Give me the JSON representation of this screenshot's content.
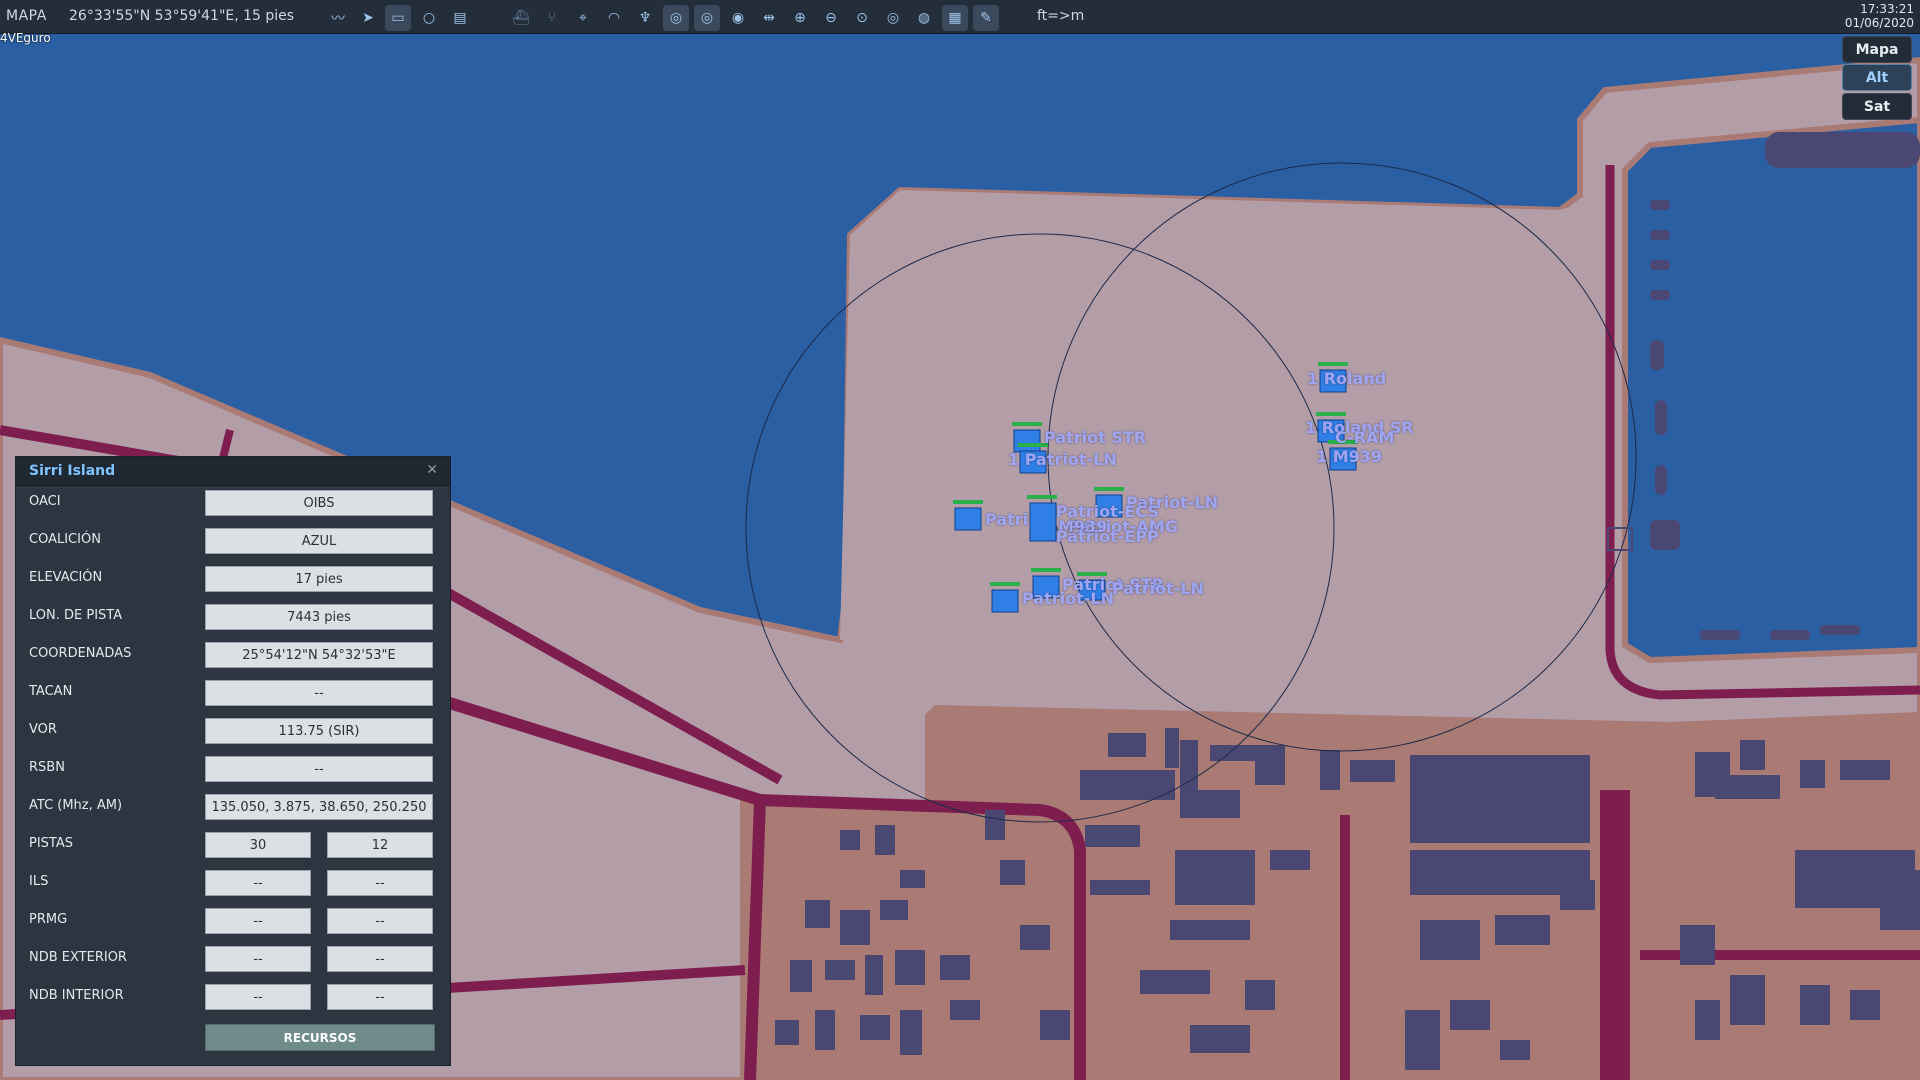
{
  "toolbar": {
    "mode": "MAPA",
    "coords": "26°33'55\"N 53°59'41\"E, 15 pies",
    "units": "ft=>m",
    "time": "17:33:21",
    "date": "01/06/2020",
    "tools": [
      {
        "icon": "route-icon"
      },
      {
        "icon": "navigate-arrow-icon"
      },
      {
        "icon": "ruler-icon"
      },
      {
        "icon": "circle-icon"
      },
      {
        "icon": "layers-icon"
      },
      {
        "icon": "ship-icon"
      },
      {
        "icon": "branch-icon"
      },
      {
        "icon": "crosshair-icon"
      },
      {
        "icon": "wifi-signal-icon"
      },
      {
        "icon": "antenna-icon"
      },
      {
        "icon": "radar-red-icon"
      },
      {
        "icon": "radar-blue-icon"
      },
      {
        "icon": "radar-all-icon"
      },
      {
        "icon": "pan-icon"
      },
      {
        "icon": "zoom-in-icon"
      },
      {
        "icon": "zoom-out-icon"
      },
      {
        "icon": "zoom-fit-icon"
      },
      {
        "icon": "target-icon"
      },
      {
        "icon": "globe-icon"
      },
      {
        "icon": "grid-icon"
      },
      {
        "icon": "pencil-icon"
      }
    ]
  },
  "corner_label": "4VEguro",
  "map_buttons": {
    "map": "Mapa",
    "alt": "Alt",
    "sat": "Sat"
  },
  "units": [
    {
      "label": "Roland",
      "prefix": "1"
    },
    {
      "label": "Roland SR",
      "prefix": "1"
    },
    {
      "label": "C-RAM",
      "prefix": "1"
    },
    {
      "label": "M939",
      "prefix": "1"
    },
    {
      "label": "Patriot STR"
    },
    {
      "label": "Patriot-LN",
      "prefix": "1"
    },
    {
      "label": "Patriot-LN"
    },
    {
      "label": "Patriot-ECS"
    },
    {
      "label": "Patriot-AMG"
    },
    {
      "label": "M939"
    },
    {
      "label": "Patriot-EPP"
    },
    {
      "label": "Patri"
    },
    {
      "label": "Patriot STR"
    },
    {
      "label": "Patriot-LN"
    },
    {
      "label": "Patriot-LN"
    }
  ],
  "panel": {
    "title": "Sirri Island",
    "rows": {
      "oaci": {
        "label": "OACI",
        "value": "OIBS"
      },
      "coalicion": {
        "label": "COALICIÓN",
        "value": "AZUL"
      },
      "elevacion": {
        "label": "ELEVACIÓN",
        "value": "17 pies"
      },
      "lon_pista": {
        "label": "LON. DE PISTA",
        "value": "7443 pies"
      },
      "coordenadas": {
        "label": "COORDENADAS",
        "value": "25°54'12\"N 54°32'53\"E"
      },
      "tacan": {
        "label": "TACAN",
        "value": "--"
      },
      "vor": {
        "label": "VOR",
        "value": "113.75 (SIR)"
      },
      "rsbn": {
        "label": "RSBN",
        "value": "--"
      },
      "atc": {
        "label": "ATC  (Mhz, AM)",
        "value": "135.050, 3.875, 38.650, 250.250"
      },
      "pistas": {
        "label": "PISTAS",
        "v1": "30",
        "v2": "12"
      },
      "ils": {
        "label": "ILS",
        "v1": "--",
        "v2": "--"
      },
      "prmg": {
        "label": "PRMG",
        "v1": "--",
        "v2": "--"
      },
      "ndb_ext": {
        "label": "NDB EXTERIOR",
        "v1": "--",
        "v2": "--"
      },
      "ndb_int": {
        "label": "NDB INTERIOR",
        "v1": "--",
        "v2": "--"
      }
    },
    "button": "RECURSOS"
  },
  "colors": {
    "sea": "#2a5fa3",
    "land": "#b39ea8",
    "urban": "#a97b74",
    "road": "#7e1e4f",
    "building": "#4a4872",
    "unit_fill": "#2f7fe6",
    "unit_label": "#9fa5f0",
    "panel_bg": "#2c3540"
  }
}
